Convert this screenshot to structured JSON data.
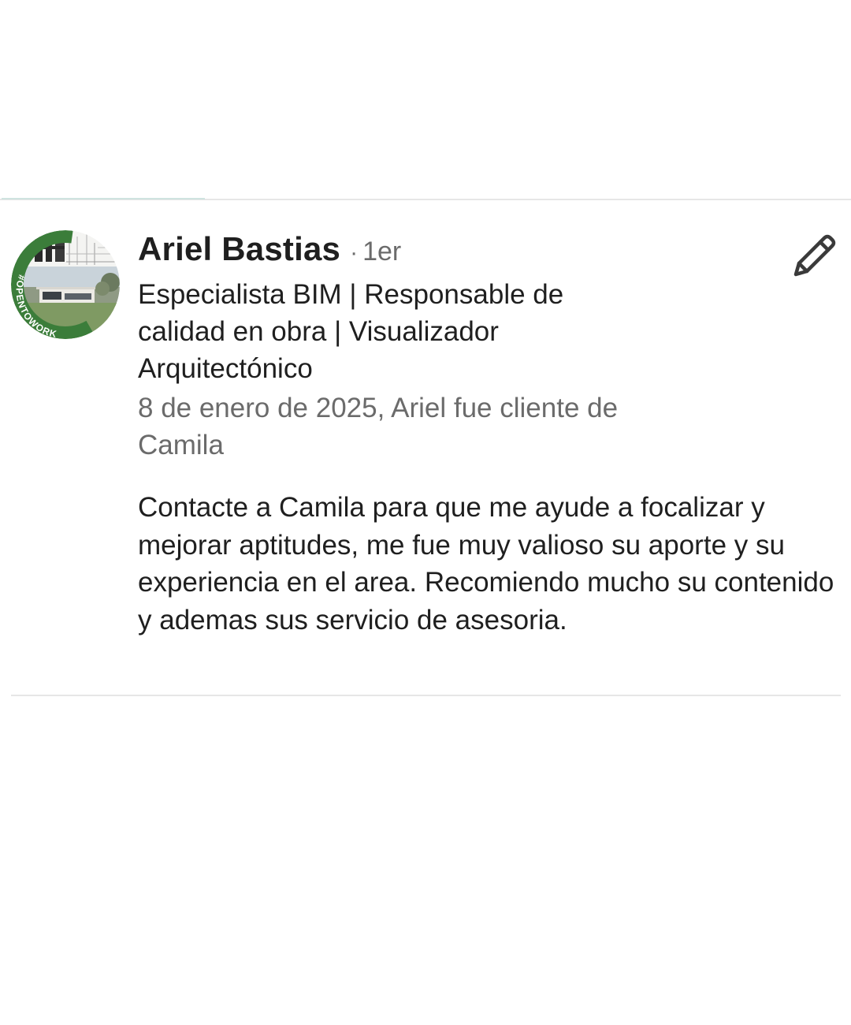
{
  "recommendation": {
    "author": {
      "name": "Ariel Bastias",
      "separator": "·",
      "degree": "1er",
      "headline": "Especialista BIM | Responsable de calidad en obra | Visualizador Arquitectónico",
      "avatar_badge": "#OPENTOWORK"
    },
    "meta": "8 de enero de 2025, Ariel fue cliente de Camila",
    "text": "Contacte a Camila para que me ayude a focalizar y mejorar aptitudes, me fue muy valioso su aporte y su experiencia en el area. Recomiendo mucho su contenido y ademas sus servicio de asesoria."
  },
  "icons": {
    "edit": "pencil-icon"
  },
  "colors": {
    "open_to_work_green": "#3b7d3a",
    "secondary_text": "#6b6b6b",
    "divider": "#e6e6e6"
  }
}
